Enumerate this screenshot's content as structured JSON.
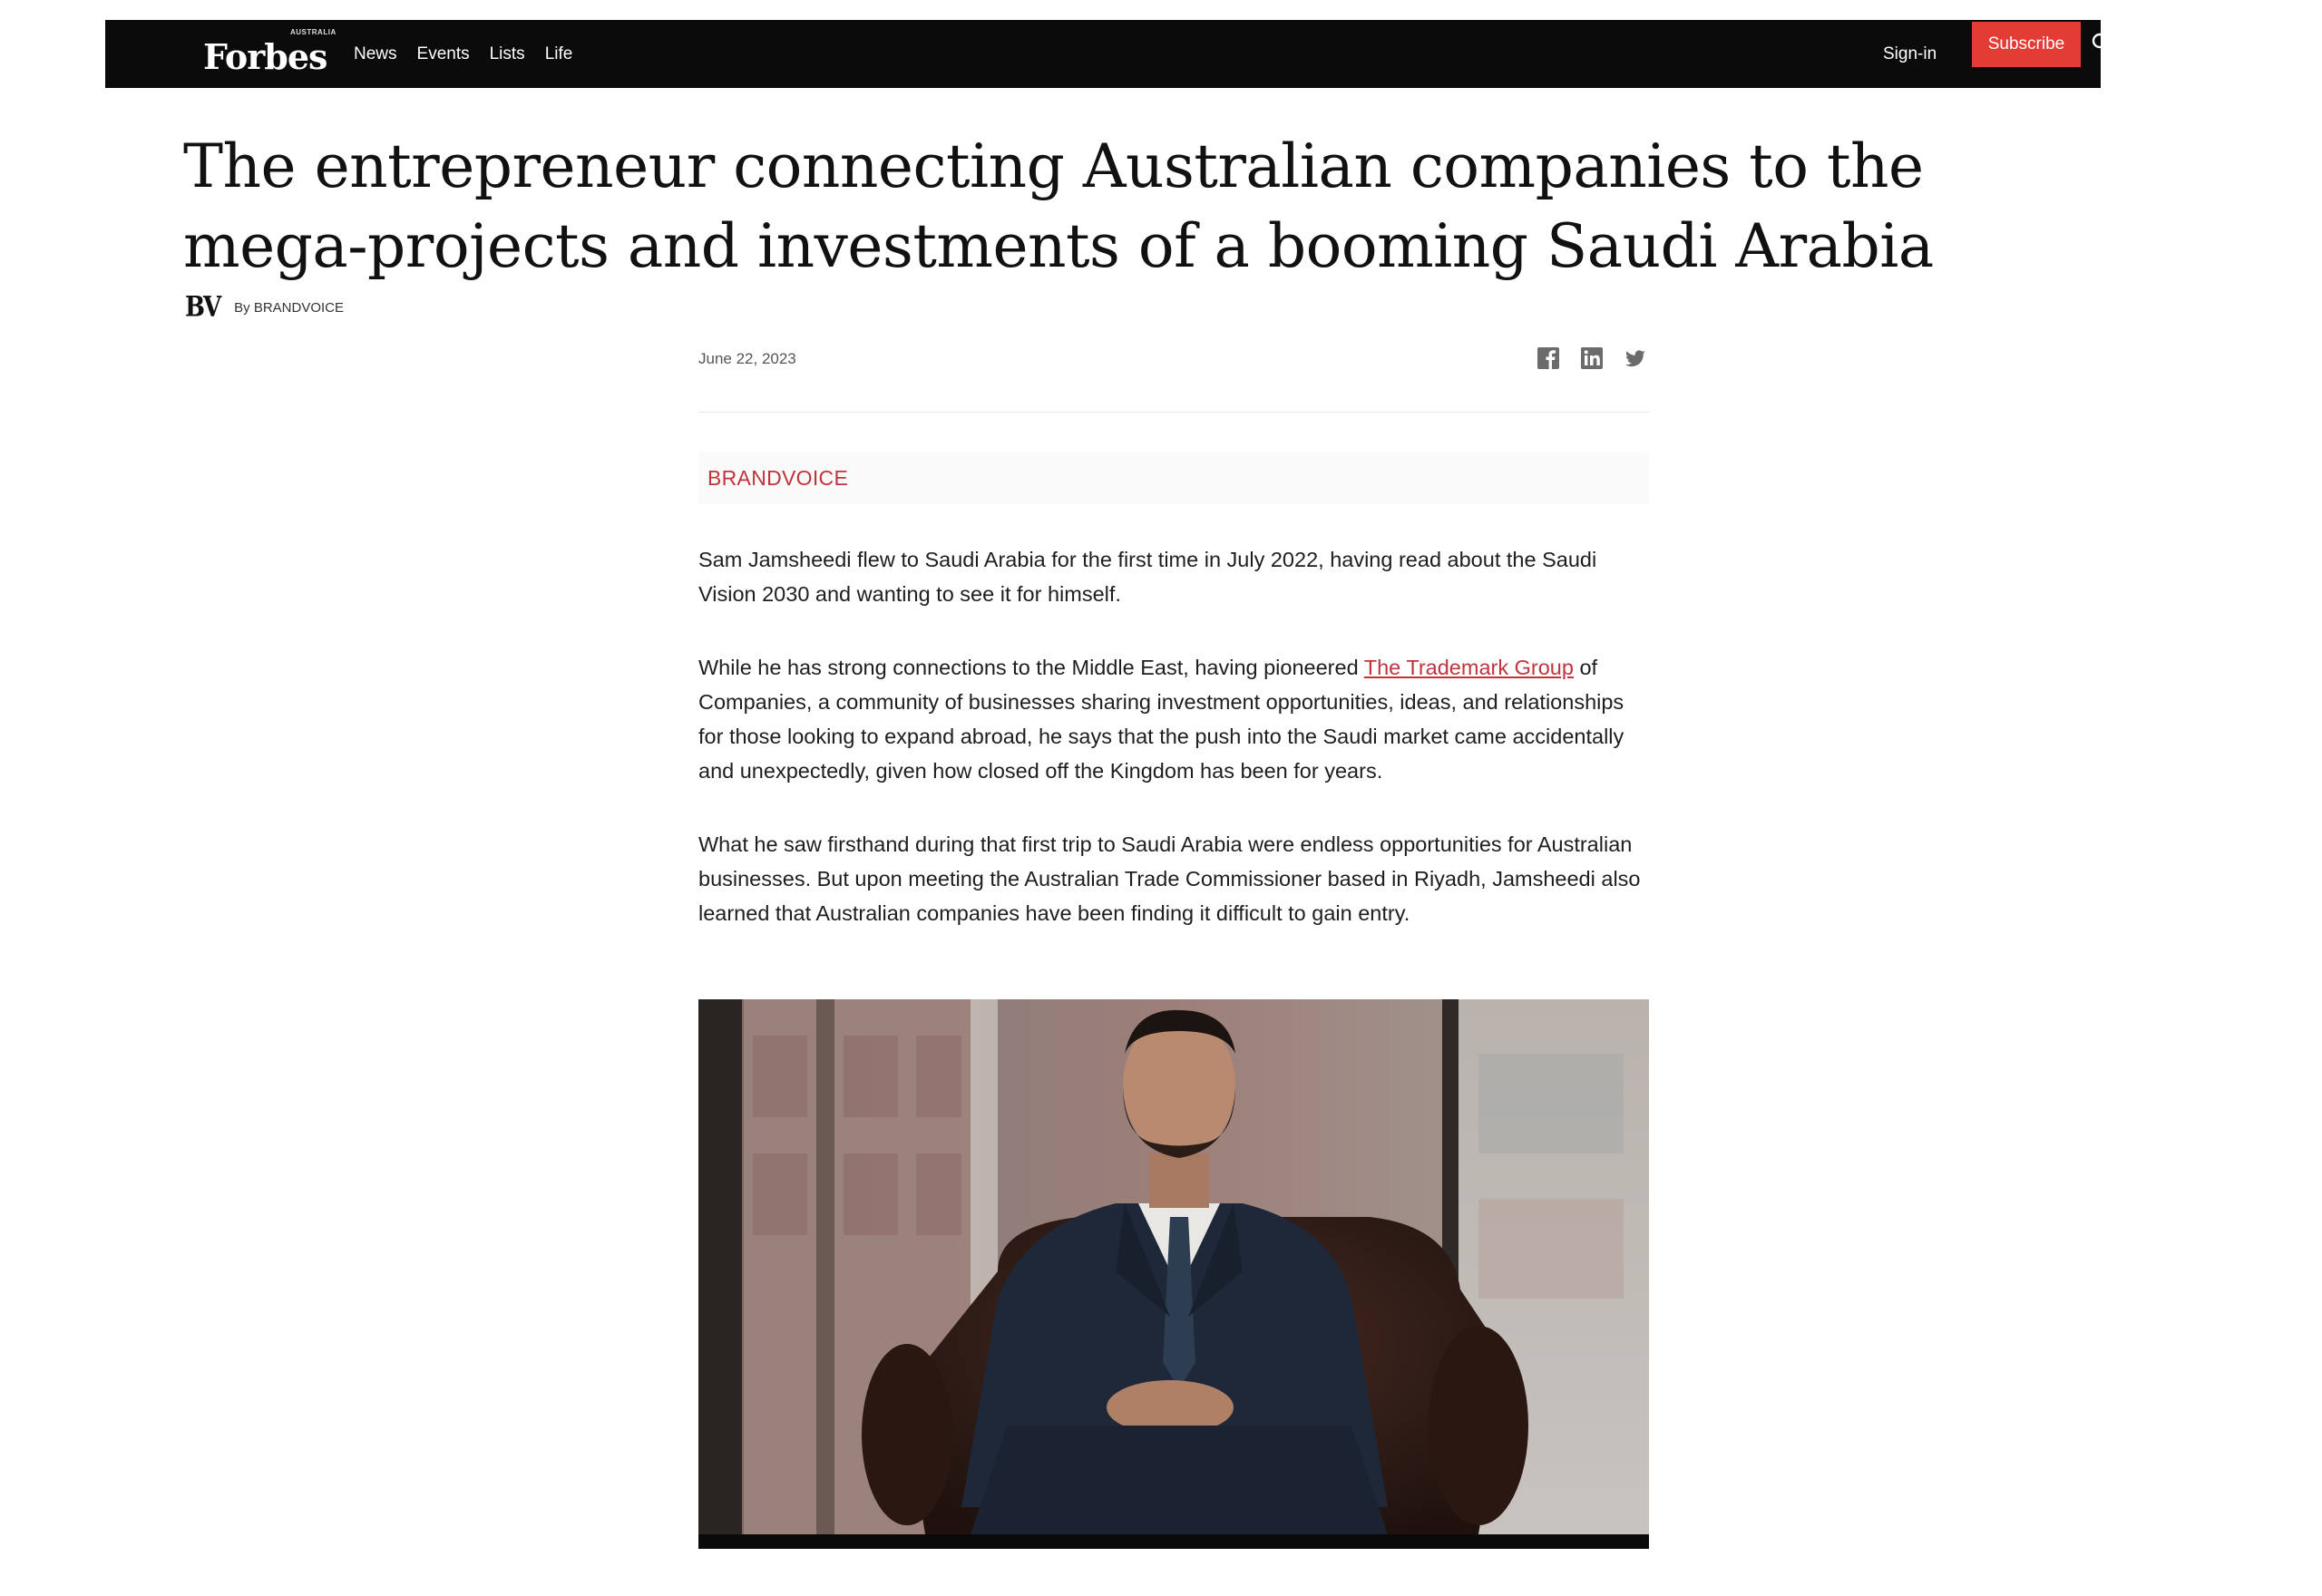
{
  "header": {
    "logo": "Forbes",
    "logo_edition": "AUSTRALIA",
    "nav": [
      "News",
      "Events",
      "Lists",
      "Life"
    ],
    "signin_label": "Sign-in",
    "subscribe_label": "Subscribe",
    "search_icon": "search-icon"
  },
  "article": {
    "title": "The entrepreneur connecting Australian companies to the mega-projects and investments of a booming Saudi Arabia",
    "byline_logo": "BV",
    "byline": "By BRANDVOICE",
    "date": "June 22, 2023",
    "share_icons": [
      "facebook-icon",
      "linkedin-icon",
      "twitter-icon"
    ],
    "section_label": "BRANDVOICE",
    "paragraphs": {
      "p1": "Sam Jamsheedi flew to Saudi Arabia for the first time in July 2022, having read about the Saudi Vision 2030 and wanting to see it for himself.",
      "p2_before": "While he has strong connections to the Middle East, having pioneered ",
      "p2_link": "The Trademark Group",
      "p2_after": " of Companies, a community of businesses sharing investment opportunities, ideas, and relationships for those looking to expand abroad, he says that the push into the Saudi market came accidentally and unexpectedly, given how closed off the Kingdom has been for years.",
      "p3": "What he saw firsthand during that first trip to Saudi Arabia were endless opportunities for Australian businesses. But upon meeting the Australian Trade Commissioner based in Riyadh, Jamsheedi also learned that Australian companies have been finding it difficult to gain entry."
    }
  },
  "colors": {
    "topbar": "#0b0b0b",
    "subscribe": "#e33c34",
    "accent": "#c0343d"
  }
}
